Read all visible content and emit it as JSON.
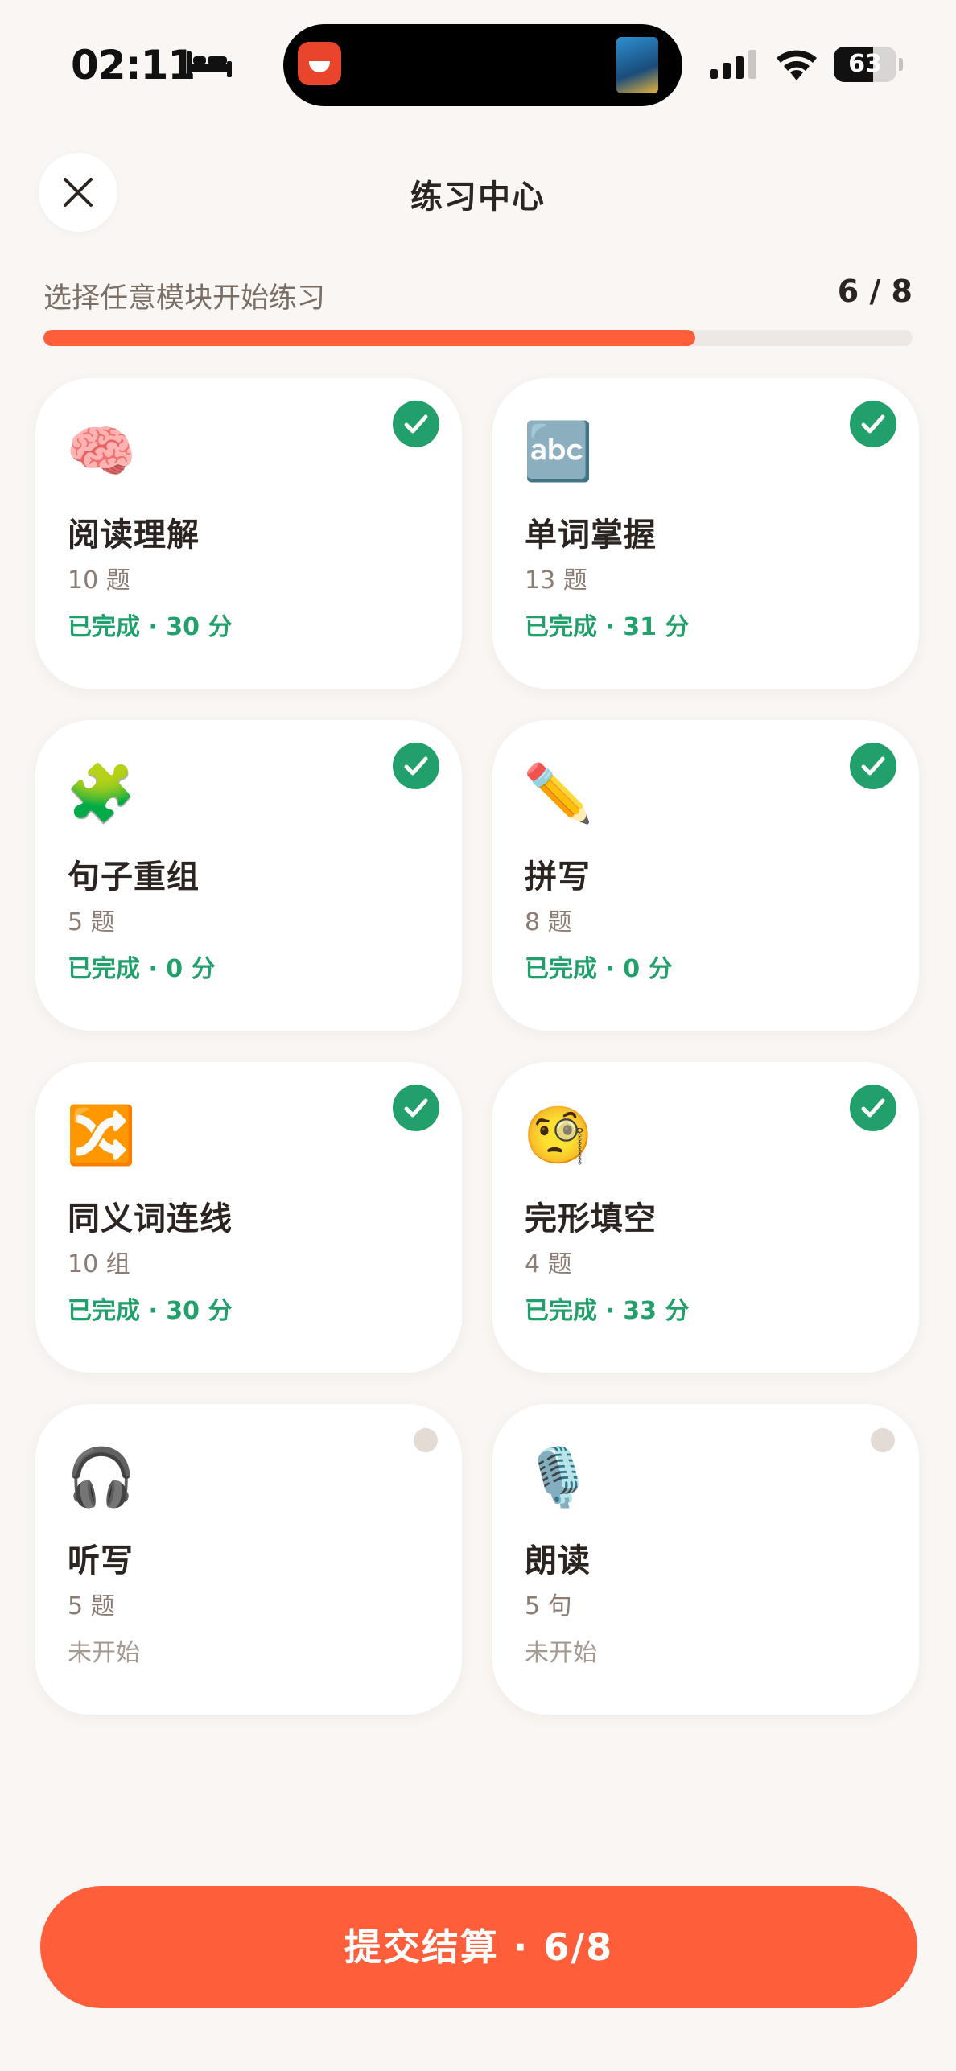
{
  "status_bar": {
    "time": "02:11",
    "battery": "63",
    "battery_level": 0.63,
    "icons": [
      "bed-icon",
      "signal-icon",
      "wifi-icon",
      "battery-icon"
    ]
  },
  "header": {
    "title": "练习中心",
    "close_icon": "close-icon"
  },
  "progress": {
    "label": "选择任意模块开始练习",
    "count": "6 / 8",
    "completed": 6,
    "total": 8
  },
  "modules": [
    {
      "emoji": "🧠",
      "icon": "brain-icon",
      "title": "阅读理解",
      "count": "10 题",
      "status": "已完成 · 30 分",
      "done": true
    },
    {
      "emoji": "🔤",
      "icon": "abc-icon",
      "title": "单词掌握",
      "count": "13 题",
      "status": "已完成 · 31 分",
      "done": true
    },
    {
      "emoji": "🧩",
      "icon": "puzzle-icon",
      "title": "句子重组",
      "count": "5 题",
      "status": "已完成 · 0 分",
      "done": true
    },
    {
      "emoji": "✏️",
      "icon": "pencil-icon",
      "title": "拼写",
      "count": "8 题",
      "status": "已完成 · 0 分",
      "done": true
    },
    {
      "emoji": "🔀",
      "icon": "shuffle-icon",
      "title": "同义词连线",
      "count": "10 组",
      "status": "已完成 · 30 分",
      "done": true
    },
    {
      "emoji": "🧐",
      "icon": "monocle-face-icon",
      "title": "完形填空",
      "count": "4 题",
      "status": "已完成 · 33 分",
      "done": true
    },
    {
      "emoji": "🎧",
      "icon": "headphones-icon",
      "title": "听写",
      "count": "5 题",
      "status": "未开始",
      "done": false
    },
    {
      "emoji": "🎙️",
      "icon": "microphone-icon",
      "title": "朗读",
      "count": "5 句",
      "status": "未开始",
      "done": false
    }
  ],
  "submit": {
    "label": "提交结算 · 6/8"
  },
  "colors": {
    "accent": "#ff5e3a",
    "success": "#22a06b",
    "background": "#f9f6f3"
  }
}
